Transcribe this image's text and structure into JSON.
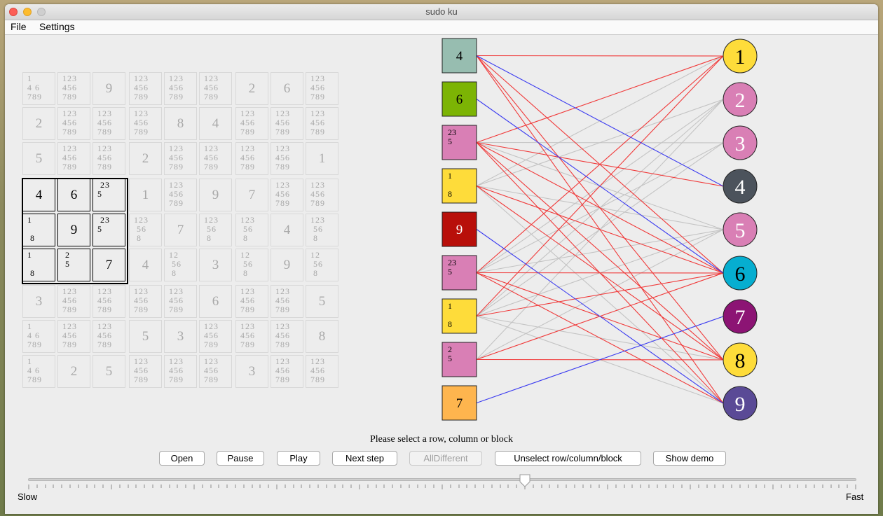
{
  "window": {
    "title": "sudo ku"
  },
  "menu": [
    "File",
    "Settings"
  ],
  "sudoku": {
    "rows": [
      [
        {
          "c": "1\n4 6\n789"
        },
        {
          "c": "123\n456\n789"
        },
        {
          "v": "9"
        },
        {
          "c": "123\n456\n789"
        },
        {
          "c": "123\n456\n789"
        },
        {
          "c": "123\n456\n789"
        },
        {
          "v": "2"
        },
        {
          "v": "6"
        },
        {
          "c": "123\n456\n789"
        }
      ],
      [
        {
          "v": "2"
        },
        {
          "c": "123\n456\n789"
        },
        {
          "c": "123\n456\n789"
        },
        {
          "c": "123\n456\n789"
        },
        {
          "v": "8"
        },
        {
          "v": "4"
        },
        {
          "c": "123\n456\n789"
        },
        {
          "c": "123\n456\n789"
        },
        {
          "c": "123\n456\n789"
        }
      ],
      [
        {
          "v": "5"
        },
        {
          "c": "123\n456\n789"
        },
        {
          "c": "123\n456\n789"
        },
        {
          "v": "2"
        },
        {
          "c": "123\n456\n789"
        },
        {
          "c": "123\n456\n789"
        },
        {
          "c": "123\n456\n789"
        },
        {
          "c": "123\n456\n789"
        },
        {
          "v": "1"
        }
      ],
      [
        {
          "v": "4",
          "s": true
        },
        {
          "v": "6",
          "s": true
        },
        {
          "c": " 23\n5",
          "s": true
        },
        {
          "v": "1"
        },
        {
          "c": "123\n456\n789"
        },
        {
          "v": "9"
        },
        {
          "v": "7"
        },
        {
          "c": "123\n456\n789"
        },
        {
          "c": "123\n456\n789"
        }
      ],
      [
        {
          "c": "1\n\n 8",
          "s": true
        },
        {
          "v": "9",
          "s": true
        },
        {
          "c": " 23\n5",
          "s": true
        },
        {
          "c": "123\n 56\n 8"
        },
        {
          "v": "7"
        },
        {
          "c": "123\n 56\n 8"
        },
        {
          "c": "123\n 56\n 8"
        },
        {
          "v": "4"
        },
        {
          "c": "123\n 56\n 8"
        }
      ],
      [
        {
          "c": "1\n\n 8",
          "s": true
        },
        {
          "c": " 2\n 5",
          "s": true
        },
        {
          "v": "7",
          "s": true
        },
        {
          "v": "4"
        },
        {
          "c": "12\n 56\n 8"
        },
        {
          "v": "3"
        },
        {
          "c": "12\n 56\n 8"
        },
        {
          "v": "9"
        },
        {
          "c": "12\n 56\n 8"
        }
      ],
      [
        {
          "v": "3"
        },
        {
          "c": "123\n456\n789"
        },
        {
          "c": "123\n456\n789"
        },
        {
          "c": "123\n456\n789"
        },
        {
          "c": "123\n456\n789"
        },
        {
          "v": "6"
        },
        {
          "c": "123\n456\n789"
        },
        {
          "c": "123\n456\n789"
        },
        {
          "v": "5"
        }
      ],
      [
        {
          "c": "1\n4 6\n789"
        },
        {
          "c": "123\n456\n789"
        },
        {
          "c": "123\n456\n789"
        },
        {
          "v": "5"
        },
        {
          "v": "3"
        },
        {
          "c": "123\n456\n789"
        },
        {
          "c": "123\n456\n789"
        },
        {
          "c": "123\n456\n789"
        },
        {
          "v": "8"
        }
      ],
      [
        {
          "c": "1\n4 6\n789"
        },
        {
          "v": "2"
        },
        {
          "v": "5"
        },
        {
          "c": "123\n456\n789"
        },
        {
          "c": "123\n456\n789"
        },
        {
          "c": "123\n456\n789"
        },
        {
          "v": "3"
        },
        {
          "c": "123\n456\n789"
        },
        {
          "c": "123\n456\n789"
        }
      ]
    ]
  },
  "graph": {
    "left_nodes": [
      {
        "label": "4",
        "color": "#97bdb0",
        "cand": false
      },
      {
        "label": "6",
        "color": "#7cb404",
        "cand": false
      },
      {
        "label": " 23\n5",
        "color": "#d97fb5",
        "cand": true
      },
      {
        "label": "1\n\n 8",
        "color": "#fedc3a",
        "cand": true
      },
      {
        "label": "9",
        "color": "#b80f0a",
        "cand": false,
        "text_color": "#ffffff"
      },
      {
        "label": " 23\n5",
        "color": "#d97fb5",
        "cand": true
      },
      {
        "label": "1\n\n 8",
        "color": "#fedc3a",
        "cand": true
      },
      {
        "label": " 2\n 5",
        "color": "#d97fb5",
        "cand": true
      },
      {
        "label": "7",
        "color": "#feb54e",
        "cand": false
      }
    ],
    "right_nodes": [
      {
        "label": "1",
        "color": "#fedc3a",
        "text": "#000000"
      },
      {
        "label": "2",
        "color": "#d97fb5",
        "text": "#ffffff"
      },
      {
        "label": "3",
        "color": "#d97fb5",
        "text": "#ffffff"
      },
      {
        "label": "4",
        "color": "#4c535c",
        "text": "#ffffff"
      },
      {
        "label": "5",
        "color": "#d97fb5",
        "text": "#ffffff"
      },
      {
        "label": "6",
        "color": "#06aed0",
        "text": "#000000"
      },
      {
        "label": "7",
        "color": "#8c1474",
        "text": "#ffffff"
      },
      {
        "label": "8",
        "color": "#fedc3a",
        "text": "#000000"
      },
      {
        "label": "9",
        "color": "#5a4a96",
        "text": "#ffffff"
      }
    ],
    "edges": {
      "blue": [
        [
          0,
          3
        ],
        [
          1,
          5
        ],
        [
          4,
          8
        ],
        [
          8,
          6
        ]
      ],
      "red": [
        [
          0,
          0
        ],
        [
          0,
          5
        ],
        [
          0,
          7
        ],
        [
          0,
          8
        ],
        [
          2,
          0
        ],
        [
          2,
          3
        ],
        [
          2,
          5
        ],
        [
          2,
          7
        ],
        [
          2,
          8
        ],
        [
          3,
          5
        ],
        [
          3,
          7
        ],
        [
          5,
          0
        ],
        [
          5,
          5
        ],
        [
          5,
          7
        ],
        [
          5,
          8
        ],
        [
          6,
          0
        ],
        [
          6,
          5
        ],
        [
          7,
          5
        ],
        [
          7,
          7
        ]
      ],
      "gray": [
        [
          2,
          2
        ],
        [
          2,
          4
        ],
        [
          3,
          0
        ],
        [
          3,
          1
        ],
        [
          3,
          4
        ],
        [
          5,
          1
        ],
        [
          5,
          2
        ],
        [
          5,
          4
        ],
        [
          6,
          1
        ],
        [
          6,
          2
        ],
        [
          6,
          4
        ],
        [
          6,
          7
        ],
        [
          7,
          1
        ],
        [
          7,
          4
        ],
        [
          3,
          8
        ],
        [
          6,
          8
        ]
      ]
    },
    "colors": {
      "blue": "#3b3bf0",
      "red": "#f03a3a",
      "gray": "#c4c4c4"
    }
  },
  "status": "Please select a row, column or block",
  "buttons": [
    {
      "label": "Open",
      "enabled": true
    },
    {
      "label": "Pause",
      "enabled": true
    },
    {
      "label": "Play",
      "enabled": true
    },
    {
      "label": "Next step",
      "enabled": true
    },
    {
      "label": "AllDifferent",
      "enabled": false
    },
    {
      "label": "Unselect row/column/block",
      "enabled": true
    },
    {
      "label": "Show demo",
      "enabled": true
    }
  ],
  "slider": {
    "min_label": "Slow",
    "max_label": "Fast",
    "value": 0.6
  }
}
